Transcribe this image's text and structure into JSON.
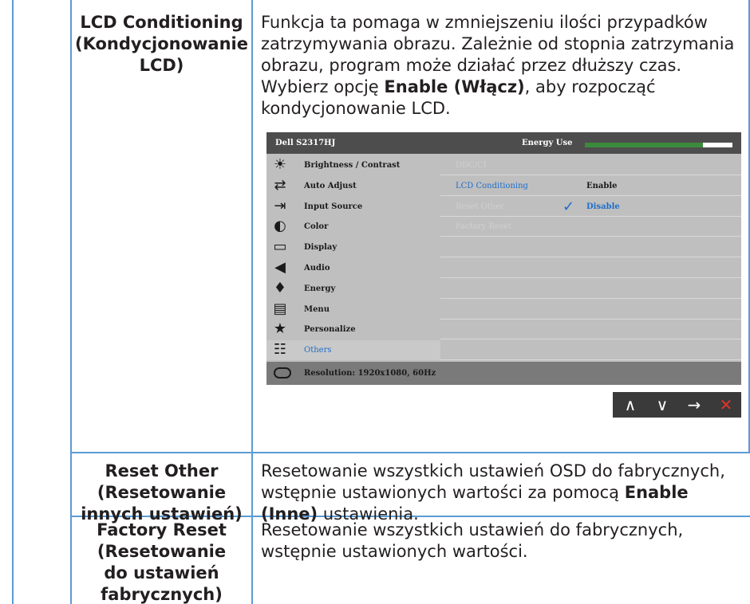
{
  "rows": [
    {
      "term": [
        "LCD Conditioning",
        "(Kondycjonowanie",
        "LCD)"
      ],
      "desc_segments": [
        {
          "text": "Funkcja ta pomaga w zmniejszeniu ilości przypadków zatrzymywania obrazu. Zależnie od stopnia zatrzymania obrazu, program może działać przez dłuższy czas. Wybierz opcję ",
          "bold": false
        },
        {
          "text": "Enable (Włącz)",
          "bold": true
        },
        {
          "text": ", aby rozpocząć kondycjonowanie LCD.",
          "bold": false
        }
      ]
    },
    {
      "term": [
        "Reset Other",
        "(Resetowanie",
        "innych ustawień)"
      ],
      "desc_segments": [
        {
          "text": "Resetowanie wszystkich ustawień OSD do fabrycznych, wstępnie ustawionych wartości za pomocą ",
          "bold": false
        },
        {
          "text": "Enable (Inne)",
          "bold": true
        },
        {
          "text": " ustawienia.",
          "bold": false
        }
      ]
    },
    {
      "term": [
        "Factory Reset",
        "(Resetowanie",
        "do ustawień",
        "fabrycznych)"
      ],
      "desc_segments": [
        {
          "text": "Resetowanie wszystkich ustawień do fabrycznych, wstępnie ustawionych wartości.",
          "bold": false
        }
      ]
    }
  ],
  "osd": {
    "title": "Dell S2317HJ",
    "energy_label": "Energy Use",
    "energy_level": 0.8,
    "menu": [
      {
        "label": "Brightness / Contrast",
        "icon": "brightness-icon",
        "glyph": "☀"
      },
      {
        "label": "Auto Adjust",
        "icon": "auto-adjust-icon",
        "glyph": "⇄"
      },
      {
        "label": "Input Source",
        "icon": "input-source-icon",
        "glyph": "⇥"
      },
      {
        "label": "Color",
        "icon": "color-icon",
        "glyph": "◐"
      },
      {
        "label": "Display",
        "icon": "display-icon",
        "glyph": "▭"
      },
      {
        "label": "Audio",
        "icon": "audio-icon",
        "glyph": "◀"
      },
      {
        "label": "Energy",
        "icon": "energy-icon",
        "glyph": "♦"
      },
      {
        "label": "Menu",
        "icon": "menu-icon",
        "glyph": "▤"
      },
      {
        "label": "Personalize",
        "icon": "star-icon",
        "glyph": "★"
      },
      {
        "label": "Others",
        "icon": "others-icon",
        "glyph": "☷",
        "selected": true
      }
    ],
    "options": [
      {
        "label": "DDC/CI",
        "value": ""
      },
      {
        "label": "LCD Conditioning",
        "value": "Enable",
        "active": true
      },
      {
        "label": "Reset Other",
        "value": "Disable",
        "checked": true
      },
      {
        "label": "Factory Reset",
        "value": ""
      }
    ],
    "footer": "Resolution: 1920x1080, 60Hz",
    "nav_buttons": [
      {
        "name": "up-button",
        "glyph": "∧"
      },
      {
        "name": "down-button",
        "glyph": "∨"
      },
      {
        "name": "enter-button",
        "glyph": "→"
      },
      {
        "name": "close-button",
        "glyph": "✕"
      }
    ]
  },
  "colors": {
    "table_border": "#5b9bd5",
    "osd_highlight": "#1e6ec8",
    "energy_bar": "#3c8a3c",
    "close_red": "#e0332b"
  }
}
